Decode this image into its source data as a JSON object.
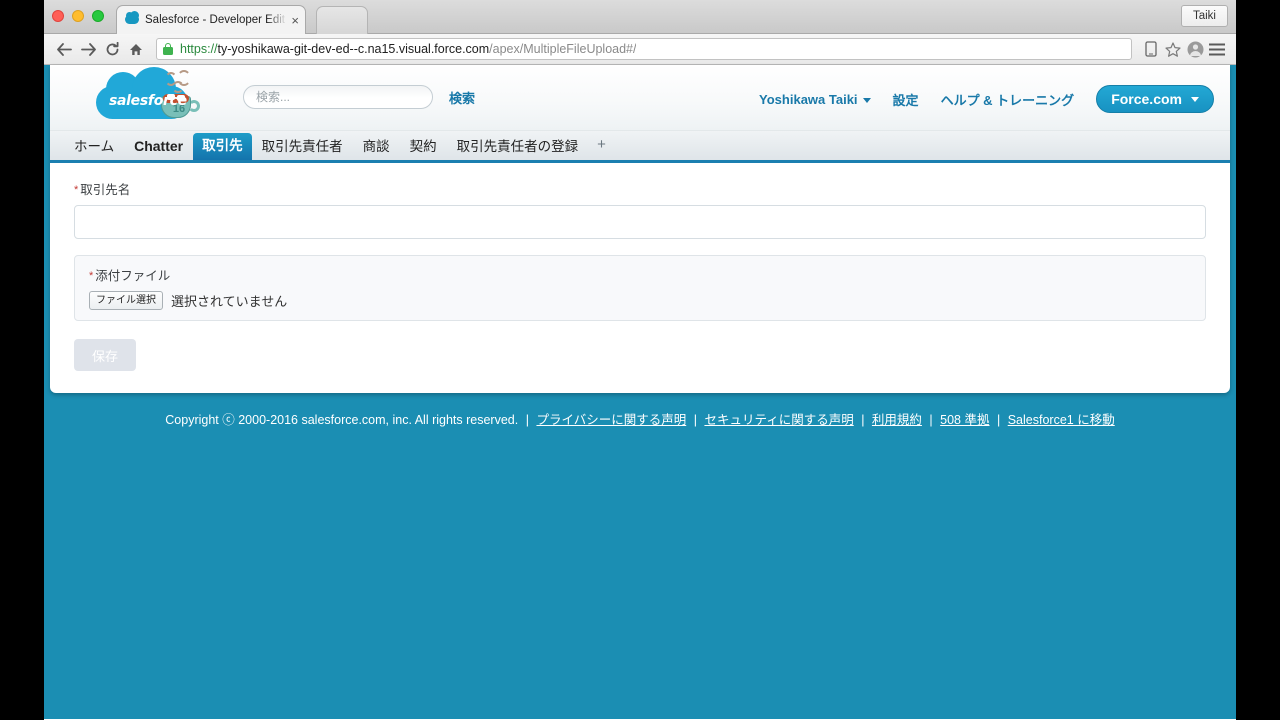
{
  "browser": {
    "tab": {
      "title": "Salesforce - Developer Edit",
      "close_label": "×"
    },
    "profile_button": "Taiki",
    "toolbar": {
      "back_icon": "back-arrow-icon",
      "forward_icon": "forward-arrow-icon",
      "reload_icon": "reload-icon",
      "home_icon": "home-icon",
      "url_scheme": "https://",
      "url_host": "ty-yoshikawa-git-dev-ed--c.na15.visual.force.com",
      "url_path": "/apex/MultipleFileUpload#/",
      "mobile_icon": "mobile-view-icon",
      "bookmark_icon": "star-icon",
      "account_icon": "account-avatar-icon",
      "menu_icon": "hamburger-menu-icon"
    }
  },
  "sf_header": {
    "logo_text": "salesforce",
    "mascot_number": "16",
    "search": {
      "placeholder": "検索...",
      "value": "",
      "button_label": "検索"
    },
    "nav": {
      "user_name": "Yoshikawa Taiki",
      "setup": "設定",
      "help": "ヘルプ & トレーニング",
      "app_switcher": "Force.com"
    }
  },
  "sf_tabs": [
    {
      "label": "ホーム",
      "active": false,
      "strong": false
    },
    {
      "label": "Chatter",
      "active": false,
      "strong": true
    },
    {
      "label": "取引先",
      "active": true,
      "strong": false
    },
    {
      "label": "取引先責任者",
      "active": false,
      "strong": false
    },
    {
      "label": "商談",
      "active": false,
      "strong": false
    },
    {
      "label": "契約",
      "active": false,
      "strong": false
    },
    {
      "label": "取引先責任者の登録",
      "active": false,
      "strong": false
    },
    {
      "label": "+",
      "active": false,
      "strong": false
    }
  ],
  "form": {
    "required_mark": "*",
    "account_name_label": "取引先名",
    "account_name_value": "",
    "attachment_label": "添付ファイル",
    "file_button_label": "ファイル選択",
    "file_status": "選択されていません",
    "save_label": "保存"
  },
  "footer": {
    "copyright": "Copyright ⓒ 2000-2016 salesforce.com, inc. All rights reserved.",
    "separator": "|",
    "links": [
      "プライバシーに関する声明",
      "セキュリティに関する声明",
      "利用規約",
      "508 準拠",
      "Salesforce1 に移動"
    ]
  },
  "colors": {
    "page_background": "#1b8eb3",
    "accent_blue": "#1979a9",
    "active_tab": "#1474ad",
    "required_red": "#c23934"
  }
}
